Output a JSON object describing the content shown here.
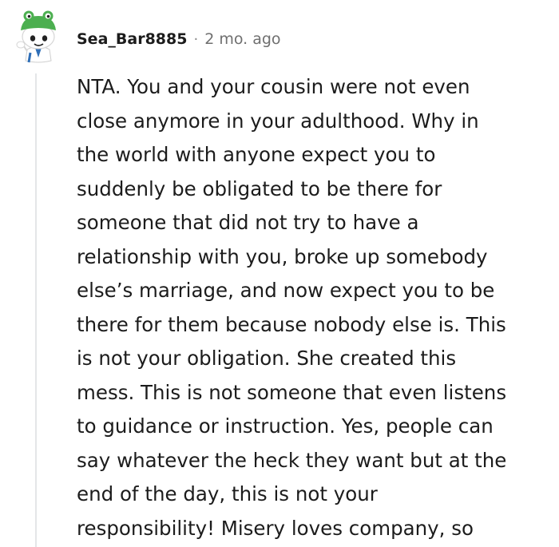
{
  "comment": {
    "author": "Sea_Bar8885",
    "separator": "·",
    "age": "2 mo. ago",
    "avatar_icon": "snoo-frog-hat-avatar-icon",
    "body_lines": [
      "NTA. You and your cousin were not even",
      "close anymore in your adulthood. Why in",
      "the world with anyone expect you to",
      "suddenly be obligated to be there for",
      "someone that did not try to have a",
      "relationship with you, broke up somebody",
      "else’s marriage, and now expect you to be",
      "there for them because nobody else is. This",
      "is not your obligation. She created this",
      "mess. This is not someone that even listens",
      "to guidance or instruction. Yes, people can",
      "say whatever the heck they want but at the",
      "end of the day, this is not your",
      "responsibility! Misery loves company, so"
    ]
  },
  "colors": {
    "text": "#1c1c1c",
    "meta_text": "#6f6f6f",
    "thread_line": "#e4e6e8",
    "avatar_frog": "#4caf50",
    "avatar_bg": "#f2f2f2"
  }
}
